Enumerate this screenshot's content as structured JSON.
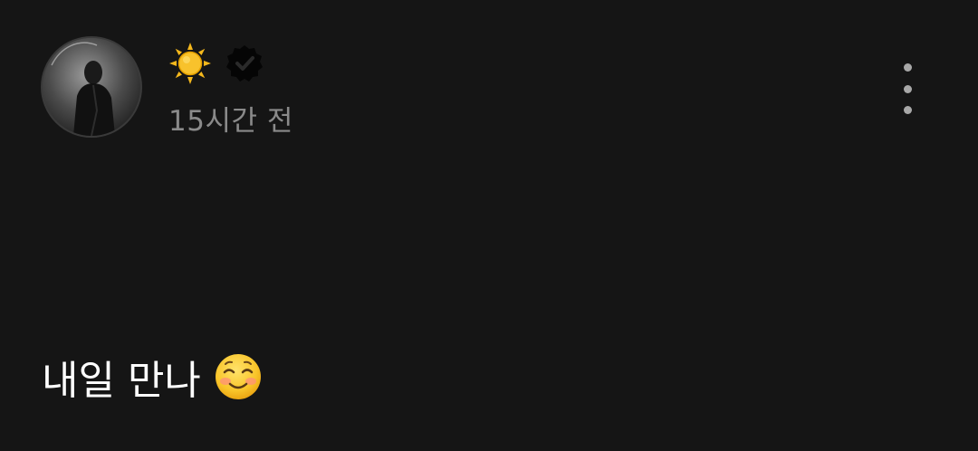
{
  "post": {
    "author": {
      "avatar_icon": "profile-photo",
      "name_icon": "sun-emoji",
      "badge_icon": "verified-badge-icon"
    },
    "timestamp": "15시간 전",
    "body": {
      "text": "내일 만나",
      "emoji_icon": "smiling-face-emoji"
    },
    "menu_icon": "more-vertical-icon"
  },
  "colors": {
    "background": "#151515",
    "timestamp": "#8a8a8a",
    "text": "#ffffff",
    "sun": "#f5b81c",
    "dots": "#a8a8a8"
  }
}
